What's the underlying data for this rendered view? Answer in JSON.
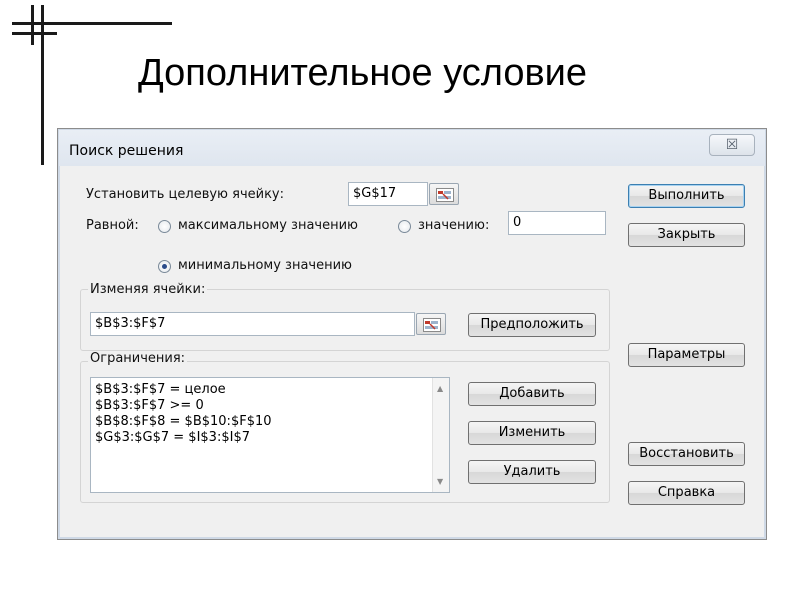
{
  "slide": {
    "title": "Дополнительное условие"
  },
  "dialog": {
    "title": "Поиск решения",
    "close_label": "☒",
    "target_label": "Установить целевую ячейку:",
    "target_value": "$G$17",
    "equal_label": "Равной:",
    "radio_max_label": "максимальному значению",
    "radio_value_label": "значению:",
    "value_field": "0",
    "radio_min_label": "минимальному значению",
    "changing_label": "Изменяя ячейки:",
    "changing_value": "$B$3:$F$7",
    "guess_label": "Предположить",
    "constraints_label": "Ограничения:",
    "constraints": [
      "$B$3:$F$7 = целое",
      "$B$3:$F$7 >= 0",
      "$B$8:$F$8 = $B$10:$F$10",
      "$G$3:$G$7 = $I$3:$I$7"
    ],
    "add_label": "Добавить",
    "change_label": "Изменить",
    "delete_label": "Удалить",
    "solve_label": "Выполнить",
    "close_btn_label": "Закрыть",
    "options_label": "Параметры",
    "reset_label": "Восстановить",
    "help_label": "Справка",
    "selected_goal": "min"
  }
}
